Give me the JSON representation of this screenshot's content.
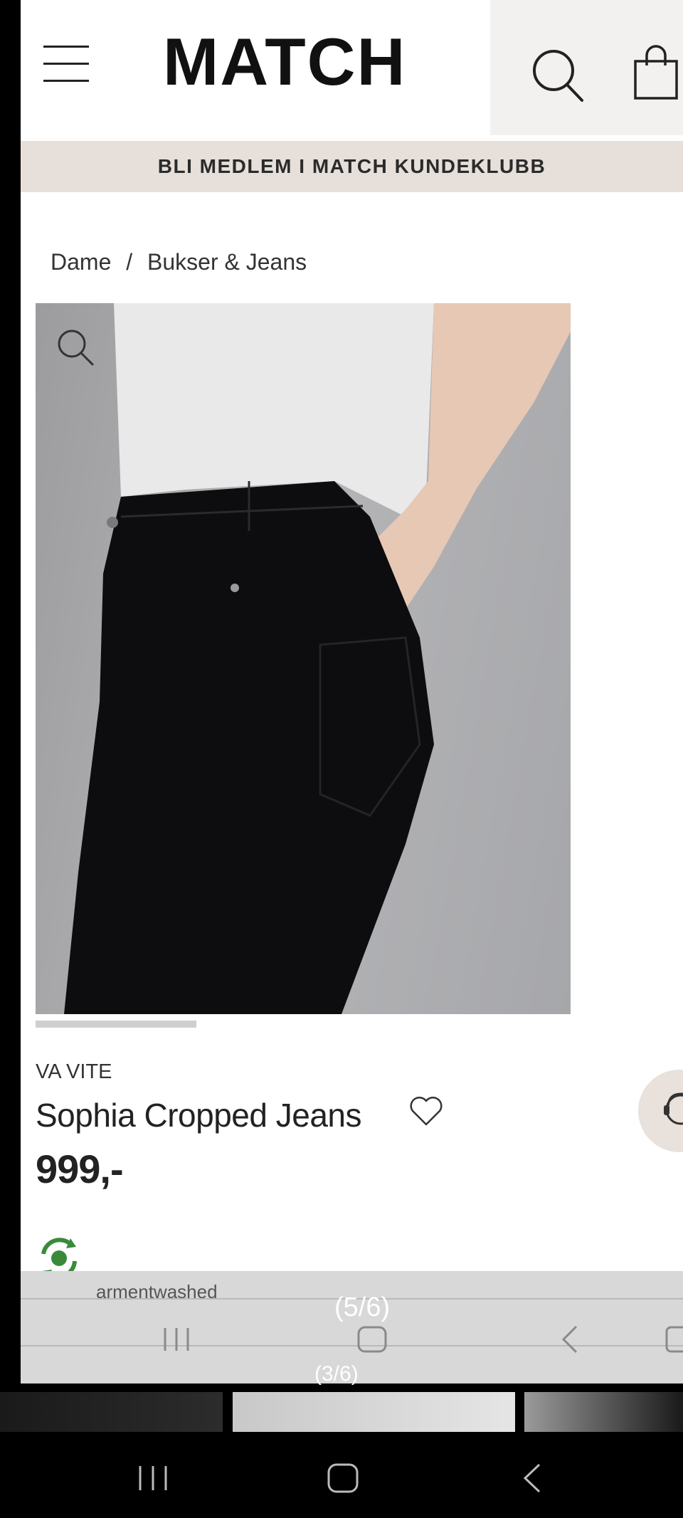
{
  "header": {
    "logo": "MATCH",
    "menu_icon": "hamburger-menu-icon",
    "search_icon": "search-icon",
    "cart_icon": "shopping-bag-icon"
  },
  "banner": {
    "text": "BLI MEDLEM I MATCH KUNDEKLUBB"
  },
  "breadcrumb": {
    "items": [
      "Dame",
      "Bukser & Jeans"
    ],
    "separator": "/"
  },
  "product": {
    "brand": "VA VITE",
    "name": "Sophia Cropped Jeans",
    "price": "999,-",
    "image_progress": 0.3,
    "partial_text": "armentwashed"
  },
  "gallery": {
    "counter_main": "(5/6)",
    "counter_thumb": "(3/6)"
  },
  "colors": {
    "banner_bg": "#e6dfda",
    "header_right_bg": "#f2f1ef",
    "text": "#222222",
    "overlay": "#d8d8d8"
  }
}
